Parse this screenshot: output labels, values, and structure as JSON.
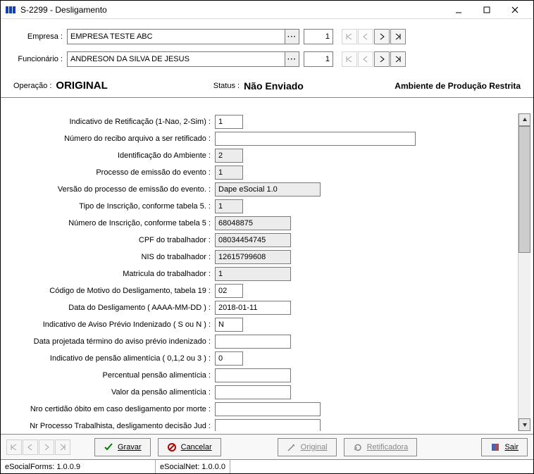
{
  "window": {
    "title": "S-2299 - Desligamento"
  },
  "header": {
    "empresa_label": "Empresa :",
    "empresa_value": "EMPRESA TESTE ABC",
    "empresa_num": "1",
    "funcionario_label": "Funcionário :",
    "funcionario_value": "ANDRESON DA SILVA DE JESUS",
    "funcionario_num": "1"
  },
  "status": {
    "operacao_label": "Operação :",
    "operacao_value": "ORIGINAL",
    "status_label": "Status :",
    "status_value": "Não Enviado",
    "ambiente": "Ambiente de Produção Restrita"
  },
  "form": {
    "f1": {
      "label": "Indicativo de Retificação (1-Nao, 2-Sim) :",
      "value": "1"
    },
    "f2": {
      "label": "Número do recibo arquivo a ser retificado :",
      "value": ""
    },
    "f3": {
      "label": "Identificação do Ambiente :",
      "value": "2"
    },
    "f4": {
      "label": "Processo de emissão do evento :",
      "value": "1"
    },
    "f5": {
      "label": "Versão do processo de emissão do evento. :",
      "value": "Dape eSocial 1.0"
    },
    "f6": {
      "label": "Tipo de Inscrição, conforme tabela 5. :",
      "value": "1"
    },
    "f7": {
      "label": "Número de Inscrição, conforme tabela 5 :",
      "value": "68048875"
    },
    "f8": {
      "label": "CPF do trabalhador :",
      "value": "08034454745"
    },
    "f9": {
      "label": "NIS do trabalhador :",
      "value": "12615799608"
    },
    "f10": {
      "label": "Matricula do trabalhador :",
      "value": "1"
    },
    "f11": {
      "label": "Código de Motivo do Desligamento, tabela 19 :",
      "value": "02"
    },
    "f12": {
      "label": "Data do Desligamento ( AAAA-MM-DD ) :",
      "value": "2018-01-11"
    },
    "f13": {
      "label": "Indicativo de Aviso Prévio Indenizado ( S ou N ) :",
      "value": "N"
    },
    "f14": {
      "label": "Data projetada término do aviso prévio indenizado :",
      "value": ""
    },
    "f15": {
      "label": "Indicativo de pensão alimentícia ( 0,1,2 ou 3 ) :",
      "value": "0"
    },
    "f16": {
      "label": "Percentual pensão alimentícia :",
      "value": ""
    },
    "f17": {
      "label": "Valor da pensão alimentícia :",
      "value": ""
    },
    "f18": {
      "label": "Nro certidão óbito em caso desligamento por morte :",
      "value": ""
    },
    "f19": {
      "label": "Nr Processo Trabalhista, desligamento decisão Jud :",
      "value": ""
    }
  },
  "footer": {
    "gravar": "Gravar",
    "cancelar": "Cancelar",
    "original": "Original",
    "retificadora": "Retificadora",
    "sair": "Sair"
  },
  "statusbar": {
    "forms": "eSocialForms: 1.0.0.9",
    "net": "eSocialNet: 1.0.0.0"
  }
}
